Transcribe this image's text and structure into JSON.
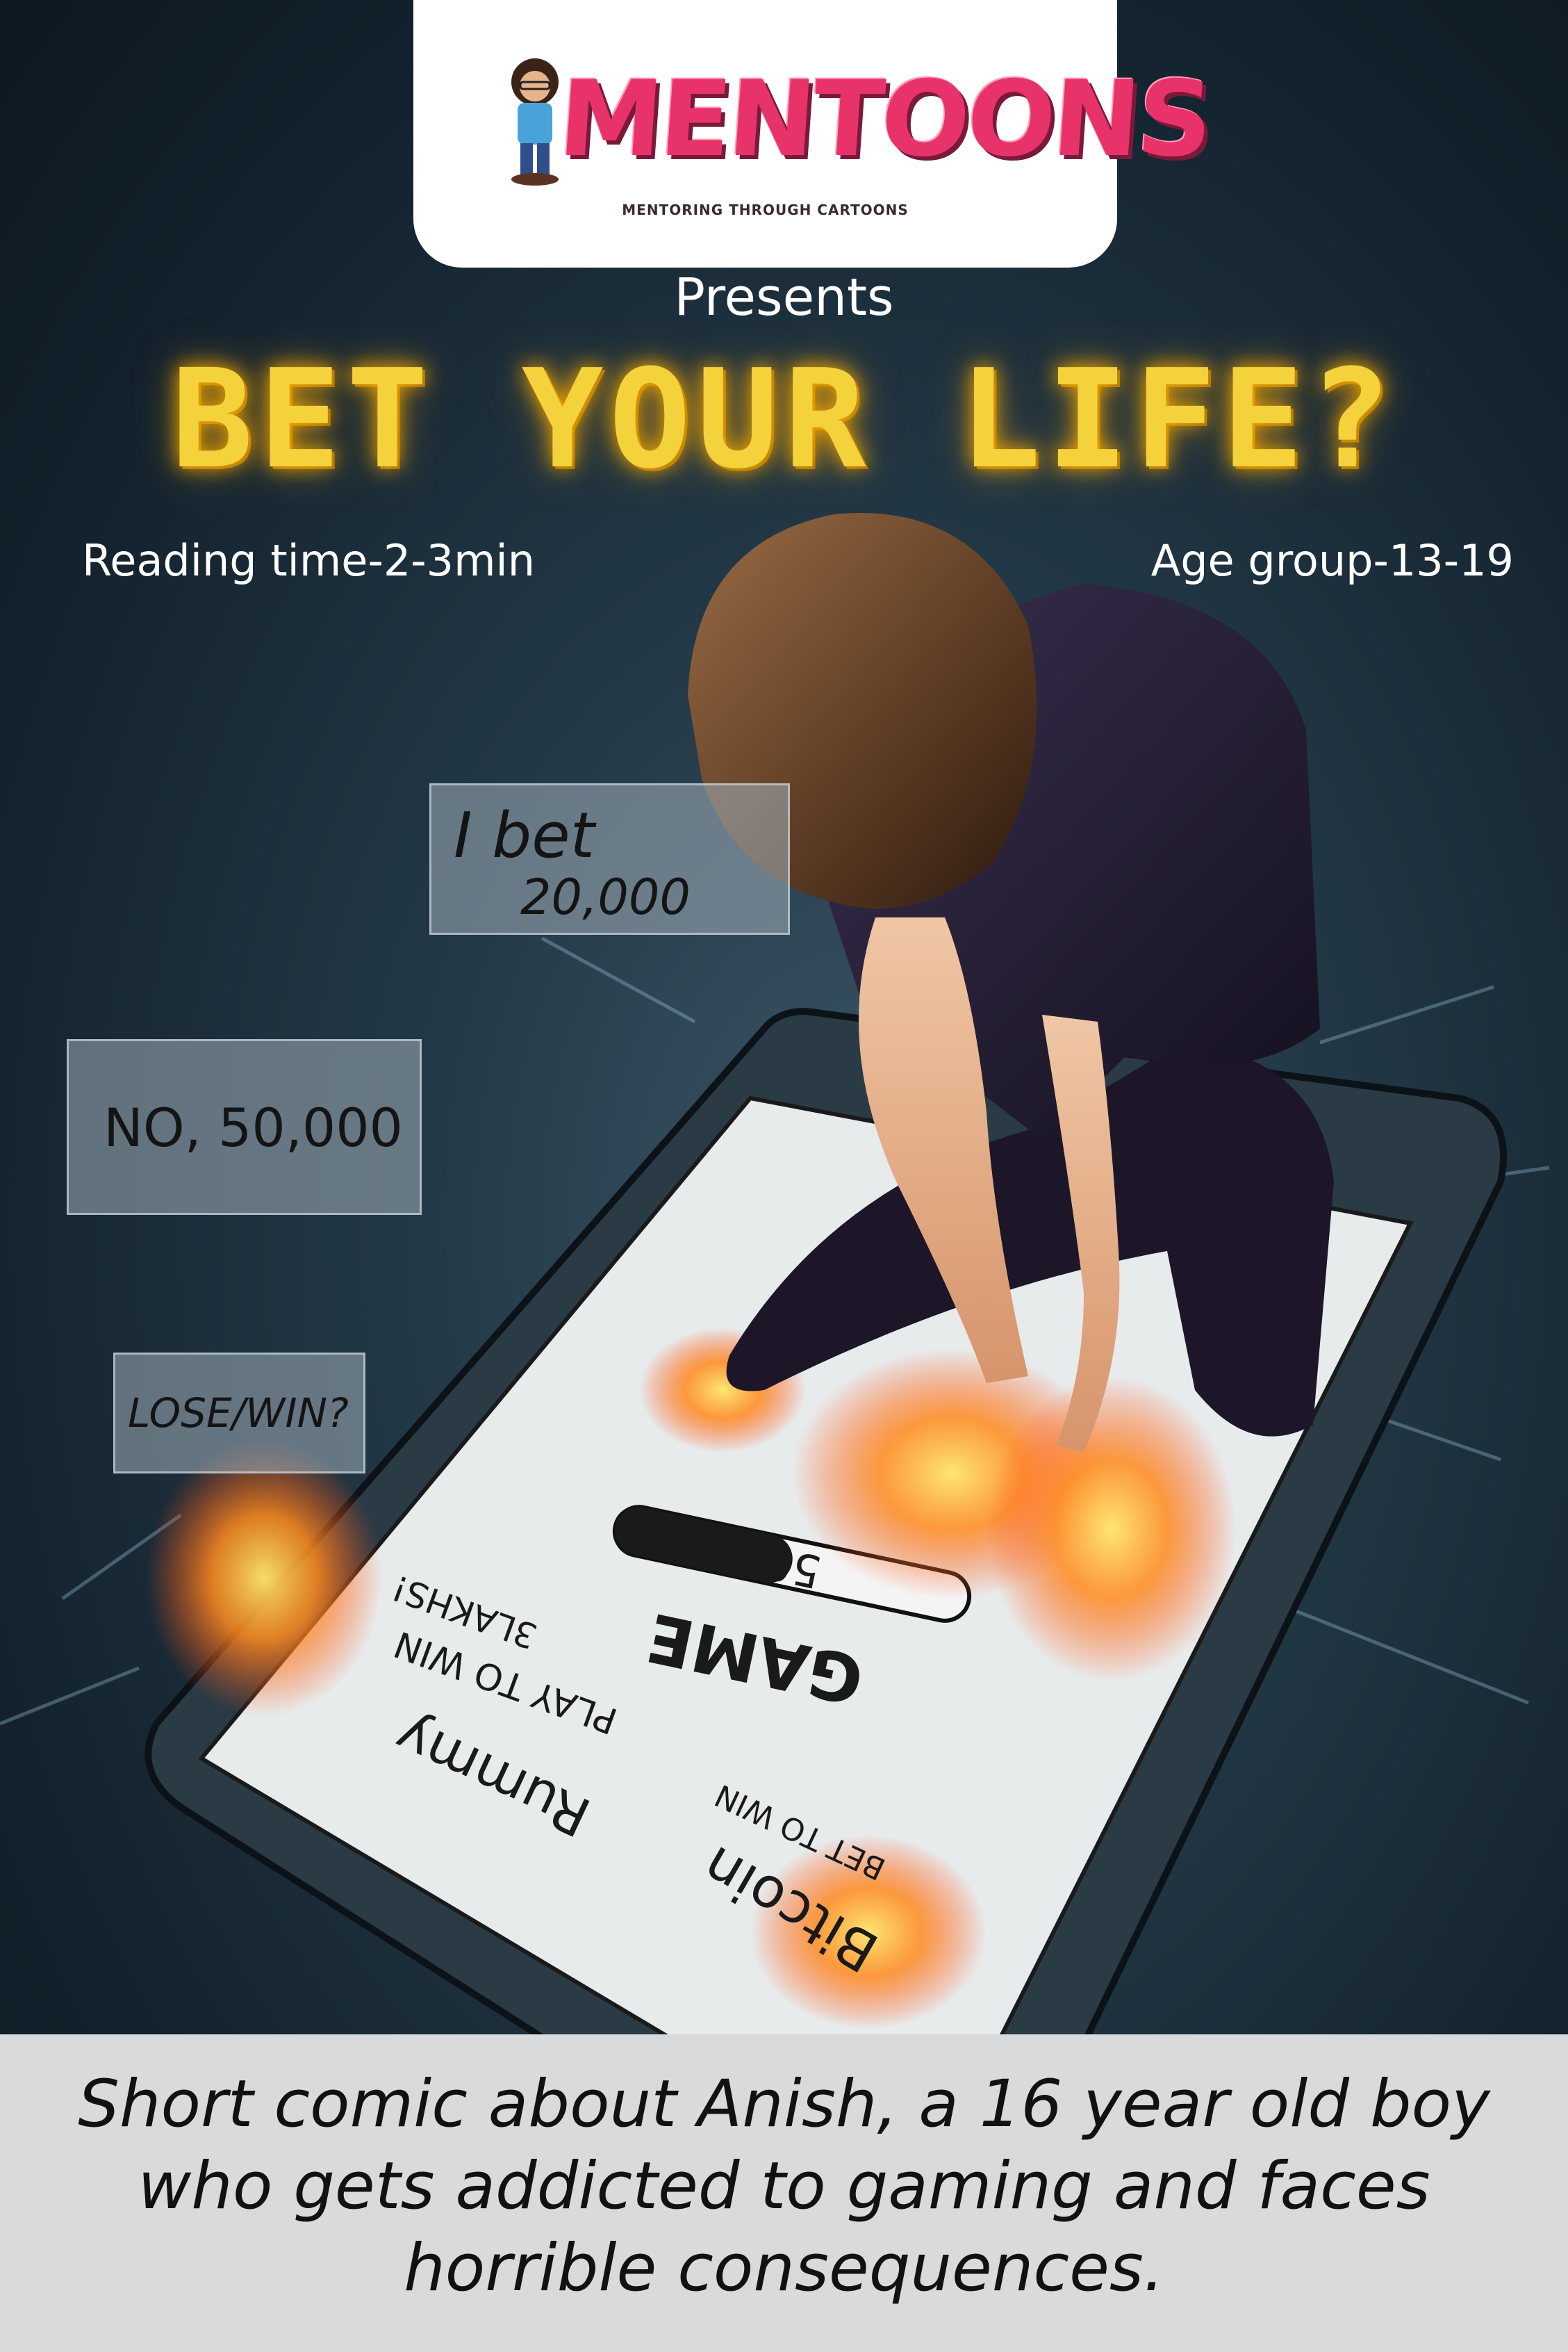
{
  "logo": {
    "name": "MENTOONS",
    "tagline": "MENTORING THROUGH CARTOONS"
  },
  "header": {
    "presents": "Presents",
    "title": "BET YOUR LIFE?"
  },
  "info": {
    "reading_time": "Reading time-2-3min",
    "age_group": "Age group-13-19"
  },
  "bubbles": {
    "bet_line1": "I bet",
    "bet_line2": "20,000",
    "counter": "NO, 50,000",
    "question": "LOSE/WIN?"
  },
  "phone_screen": {
    "progress_label": "50%",
    "progress": 0.5,
    "game_label": "GAME",
    "rummy_title": "Rummy",
    "rummy_sub": "PLAY TO WIN",
    "rummy_prize": "3LAKHS!",
    "bitcoin_title": "Bitcoin",
    "bitcoin_sub": "BET TO WIN"
  },
  "caption": {
    "text": "Short comic about Anish, a 16 year old boy who gets addicted to gaming and faces horrible consequences."
  },
  "colors": {
    "background": "#1b2e3a",
    "title_glow": "#f4d23c",
    "logo_pink": "#e8336a",
    "fire": "#ff7a1a"
  }
}
